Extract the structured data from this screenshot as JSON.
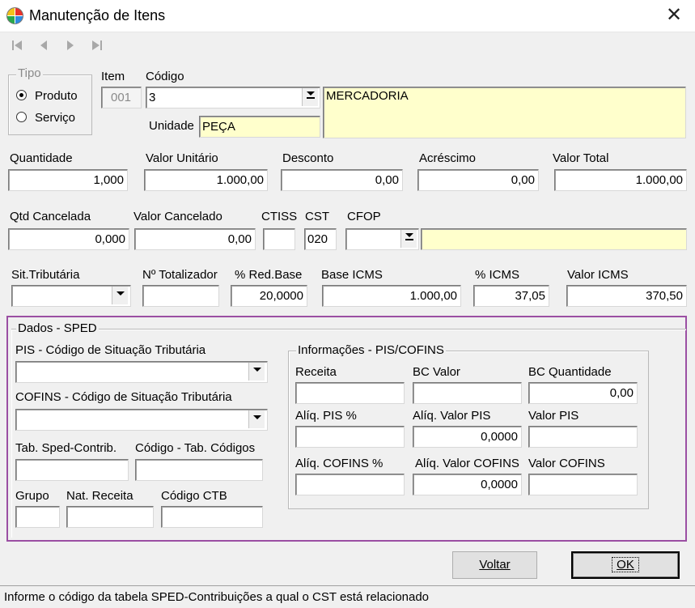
{
  "window": {
    "title": "Manutenção de Itens",
    "close_glyph": "✕"
  },
  "nav": {
    "first": "⏮",
    "prev": "◀",
    "next": "▶",
    "last": "⏭"
  },
  "tipo": {
    "legend": "Tipo",
    "produto": "Produto",
    "servico": "Serviço",
    "selected": "Produto"
  },
  "item": {
    "label": "Item",
    "value": "001"
  },
  "codigo": {
    "label": "Código",
    "value": "3",
    "description": "MERCADORIA"
  },
  "unidade": {
    "label": "Unidade",
    "value": "PEÇA"
  },
  "row1": {
    "quantidade": {
      "label": "Quantidade",
      "value": "1,000"
    },
    "valor_unitario": {
      "label": "Valor Unitário",
      "value": "1.000,00"
    },
    "desconto": {
      "label": "Desconto",
      "value": "0,00"
    },
    "acrescimo": {
      "label": "Acréscimo",
      "value": "0,00"
    },
    "valor_total": {
      "label": "Valor Total",
      "value": "1.000,00"
    }
  },
  "row2": {
    "qtd_cancelada": {
      "label": "Qtd Cancelada",
      "value": "0,000"
    },
    "valor_cancelado": {
      "label": "Valor Cancelado",
      "value": "0,00"
    },
    "ctiss": {
      "label": "CTISS",
      "value": ""
    },
    "cst": {
      "label": "CST",
      "value": "020"
    },
    "cfop": {
      "label": "CFOP",
      "value": ""
    }
  },
  "row3": {
    "sit_tributaria": {
      "label": "Sit.Tributária",
      "value": ""
    },
    "n_totalizador": {
      "label": "Nº Totalizador",
      "value": ""
    },
    "red_base": {
      "label": "% Red.Base",
      "value": "20,0000"
    },
    "base_icms": {
      "label": "Base ICMS",
      "value": "1.000,00"
    },
    "pct_icms": {
      "label": "% ICMS",
      "value": "37,05"
    },
    "valor_icms": {
      "label": "Valor ICMS",
      "value": "370,50"
    }
  },
  "sped": {
    "legend": "Dados - SPED",
    "pis_label": "PIS -  Código de Situação Tributária",
    "cofins_label": "COFINS -  Código de Situação Tributária",
    "tab_sped_label": "Tab. Sped-Contrib.",
    "codigo_tab_label": "Código - Tab. Códigos",
    "grupo_label": "Grupo",
    "nat_receita_label": "Nat. Receita",
    "codigo_ctb_label": "Código CTB",
    "info": {
      "legend": "Informações - PIS/COFINS",
      "receita": {
        "label": "Receita",
        "value": ""
      },
      "bc_valor": {
        "label": "BC Valor",
        "value": ""
      },
      "bc_quantidade": {
        "label": "BC Quantidade",
        "value": "0,00"
      },
      "aliq_pis": {
        "label": "Alíq. PIS %",
        "value": ""
      },
      "aliq_valor_pis": {
        "label": "Alíq. Valor PIS",
        "value": "0,0000"
      },
      "valor_pis": {
        "label": "Valor PIS",
        "value": ""
      },
      "aliq_cofins": {
        "label": "Alíq. COFINS %",
        "value": ""
      },
      "aliq_valor_cofins": {
        "label": "Alíq. Valor COFINS",
        "value": "0,0000"
      },
      "valor_cofins": {
        "label": "Valor COFINS",
        "value": ""
      }
    },
    "border_color": "#9b4fa3"
  },
  "buttons": {
    "voltar": "Voltar",
    "ok": "OK"
  },
  "status": "Informe o código da tabela SPED-Contribuições a qual o CST está relacionado"
}
